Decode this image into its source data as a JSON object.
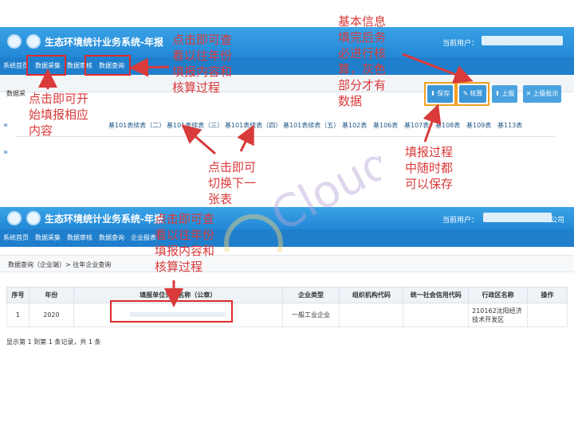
{
  "top": {
    "system_title": "生态环境统计业务系统-年报",
    "current_user_label": "当前用户：",
    "nav_items": [
      "系统首页",
      "数据采集",
      "数据审核",
      "数据查询"
    ],
    "breadcrumb": "数据采",
    "buttons": {
      "save": "保存",
      "check": "核算",
      "report": "上报",
      "approve": "上级批示"
    },
    "tabs": [
      "基101表续表（二）",
      "基101表续表（三）",
      "基101表续表（四）",
      "基101表续表（五）",
      "基102表",
      "基106表",
      "基107表",
      "基108表",
      "基109表",
      "基113表"
    ],
    "side_arrows": [
      "«",
      "»"
    ]
  },
  "bottom": {
    "system_title": "生态环境统计业务系统-年报",
    "current_user_label": "当前用户：",
    "user_suffix": "公司",
    "nav_items": [
      "系统首页",
      "数据采集",
      "数据审核",
      "数据查询",
      "企业报表"
    ],
    "breadcrumb": "数据查询（企业端）> 往年企业查询",
    "table": {
      "headers": [
        "序号",
        "年份",
        "填报单位详细名称（公章）",
        "企业类型",
        "组织机构代码",
        "统一社会信用代码",
        "行政区名称",
        "操作"
      ],
      "rows": [
        {
          "no": "1",
          "year": "2020",
          "name": "",
          "type": "一般工业企业",
          "org_code": "",
          "credit_code": "",
          "region": "210162沈阳经济技术开发区",
          "action": ""
        }
      ]
    },
    "footer": "显示第 1 到第 1 条记录，共 1 条"
  },
  "annotations": {
    "a_open_entry": "点击即可开\n始填报相应\n内容",
    "a_view_history_top": "点击即可查\n看以往年份\n填报内容和\n核算过程",
    "a_basic_info": "基本信息\n填完后务\n必进行核\n算，灰色\n部分才有\n数据",
    "a_switch_table": "点击即可\n切换下一\n张表",
    "a_save_anytime": "填报过程\n中随时都\n可以保存",
    "a_view_history_bottom": "点击即可查\n看以往年份\n填报内容和\n核算过程"
  },
  "colors": {
    "header_blue": "#2388d6",
    "nav_blue": "#1f7fcc",
    "annotation_red": "#d93a3a",
    "button_blue": "#3b97d9",
    "button_gray": "#4aa3e0"
  }
}
